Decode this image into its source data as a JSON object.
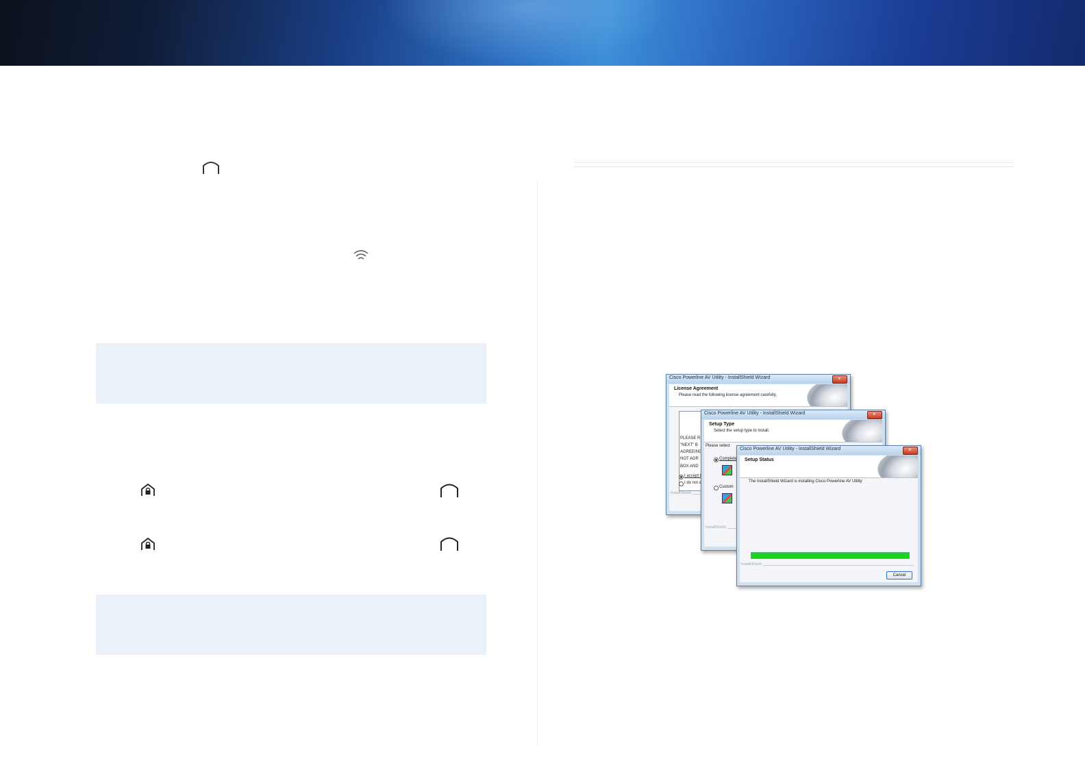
{
  "colors": {
    "banner_dark": "#0b111c",
    "banner_mid": "#2d72c4",
    "banner_right": "#132a6c",
    "note_bg": "#eaf1f9",
    "progress": "#1ed31e"
  },
  "icons": {
    "inline": [
      "arch-icon",
      "wifi-icon",
      "lock-home-icon",
      "arch-icon",
      "lock-home-icon",
      "arch-icon"
    ]
  },
  "wizard": {
    "title": "Cisco Powerline AV Utility - InstallShield Wizard",
    "close_glyph": "×",
    "footer": "InstallShield",
    "license": {
      "heading": "License Agreement",
      "sub": "Please read the following license agreement carefully.",
      "body_lines": [
        "PLEASE R",
        "\"NEXT\" B",
        "AGREEING",
        "NOT AGR",
        "BOX AND"
      ],
      "accept": "I accept t",
      "decline": "I do not a"
    },
    "setup_type": {
      "heading": "Setup Type",
      "sub": "Select the setup type to install.",
      "prompt": "Please select",
      "complete": "Complete",
      "custom": "Custom"
    },
    "status": {
      "heading": "Setup Status",
      "message": "The InstallShield Wizard is installing Cisco Powerline AV Utility",
      "progress_fraction": 1.0,
      "cancel": "Cancel"
    }
  }
}
